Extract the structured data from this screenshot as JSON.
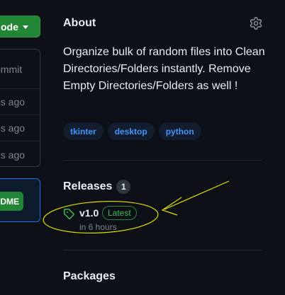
{
  "left": {
    "code_button": "ode",
    "commit_rows": [
      "ommit",
      "es ago",
      "es ago",
      "es ago"
    ],
    "readme_button": "DME"
  },
  "about": {
    "title": "About",
    "description": "Organize bulk of random files into Clean Directories/Folders instantly. Remove Empty Directories/Folders as well !",
    "topics": [
      "tkinter",
      "desktop",
      "python"
    ]
  },
  "releases": {
    "title": "Releases",
    "count": "1",
    "latest": {
      "name": "v1.0",
      "badge": "Latest",
      "time": "in 6 hours"
    }
  },
  "packages": {
    "title": "Packages"
  },
  "icons": {
    "settings": "gear-icon",
    "tag": "tag-icon",
    "dropdown": "chevron-down-icon"
  },
  "colors": {
    "background": "#0d1117",
    "accent_green": "#238636",
    "latest_green": "#3fb950",
    "topic_blue": "#4493f8",
    "annotation_yellow": "#e3e000"
  }
}
